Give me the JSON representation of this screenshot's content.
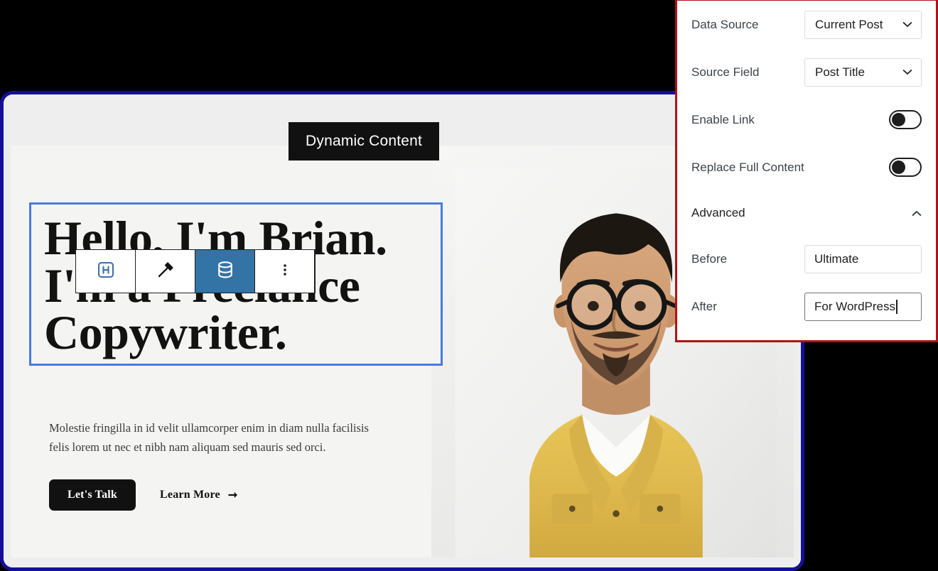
{
  "editor": {
    "tooltip": "Dynamic Content",
    "toolbar": {
      "buttons": [
        {
          "name": "heading-block-icon",
          "label": "Heading",
          "active": false
        },
        {
          "name": "style-tool-icon",
          "label": "Styles",
          "active": false
        },
        {
          "name": "dynamic-content-database-icon",
          "label": "Dynamic Content",
          "active": true
        },
        {
          "name": "more-options-icon",
          "label": "Options",
          "active": false
        }
      ]
    },
    "hero": {
      "heading_lines": [
        "Hello, I'm Brian.",
        "I'm a Freelance",
        "Copywriter."
      ],
      "paragraph": "Molestie fringilla in id velit ullamcorper enim in diam nulla facilisis felis lorem ut nec et nibh nam aliquam sed mauris sed orci.",
      "primary_button": "Let's Talk",
      "secondary_link": "Learn More",
      "secondary_link_arrow": "➞"
    }
  },
  "settings": {
    "rows": [
      {
        "label": "Data Source",
        "type": "select",
        "value": "Current Post"
      },
      {
        "label": "Source Field",
        "type": "select",
        "value": "Post Title"
      },
      {
        "label": "Enable Link",
        "type": "toggle",
        "value": "off"
      },
      {
        "label": "Replace Full Content",
        "type": "toggle",
        "value": "off"
      }
    ],
    "advanced": {
      "label": "Advanced",
      "expanded": true,
      "fields": [
        {
          "label": "Before",
          "value": "Ultimate",
          "focused": false
        },
        {
          "label": "After",
          "value": "For WordPress",
          "focused": true
        }
      ]
    }
  },
  "colors": {
    "frame_border": "#120f9c",
    "panel_border": "#b11212",
    "block_selection": "#4a7ae0",
    "toolbar_active": "#3373a5",
    "tooltip_bg": "#111111",
    "primary_button_bg": "#111111"
  }
}
